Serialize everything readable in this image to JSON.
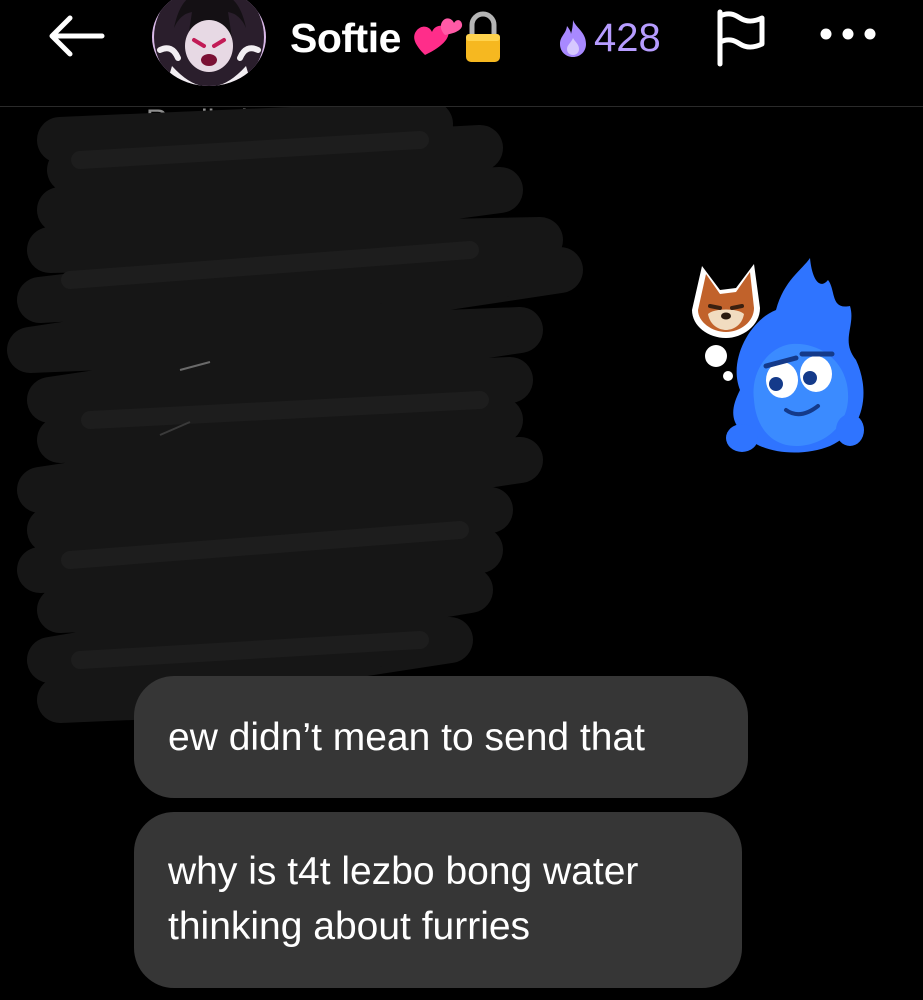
{
  "header": {
    "title": "Softie",
    "streak_count": "428",
    "icons": {
      "back": "arrow-left-icon",
      "heart": "two-hearts-emoji-icon",
      "lock": "lock-emoji-icon",
      "streak": "flame-icon",
      "report": "flag-icon",
      "more": "more-horizontal-icon"
    }
  },
  "reply": {
    "label": "Replied to you"
  },
  "sticker": {
    "name": "blue-fire-character-thinking-about-fox-sticker"
  },
  "messages": [
    {
      "text": "ew didn’t mean to send that"
    },
    {
      "lines": [
        "why is t4t lezbo bong water",
        "thinking about furries"
      ]
    }
  ],
  "colors": {
    "background": "#000000",
    "bubble": "#363636",
    "streak": "#b69cff",
    "secondary_text": "#8e8e8e"
  }
}
